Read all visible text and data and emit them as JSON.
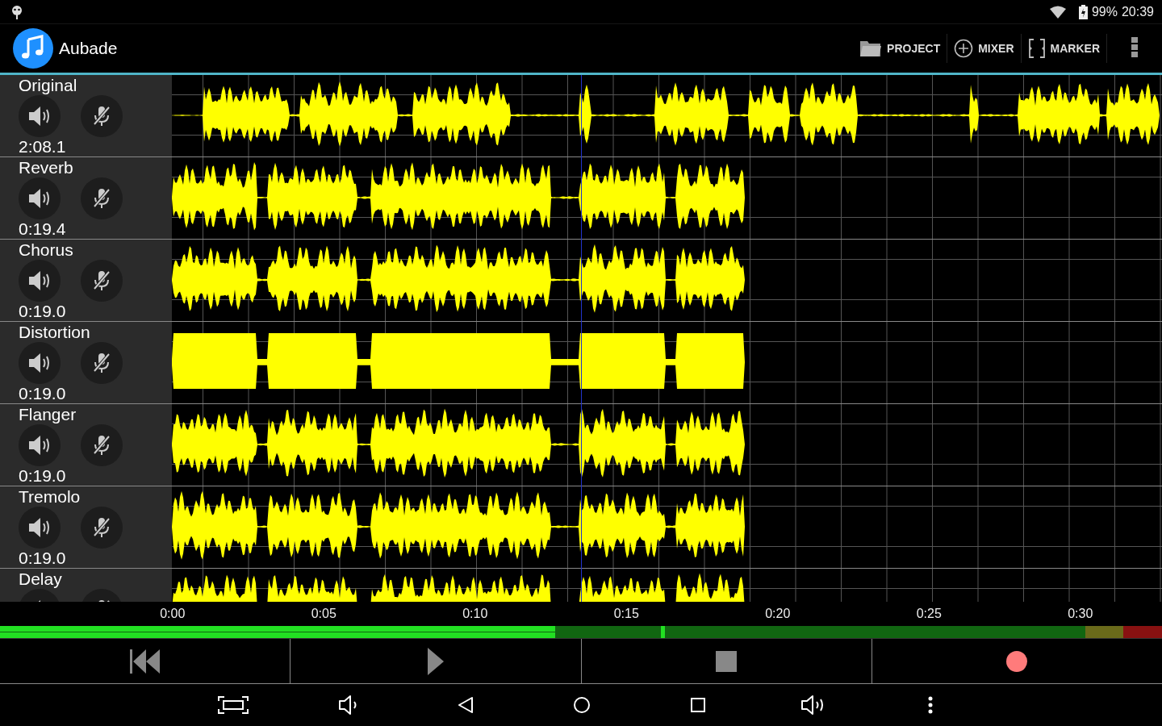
{
  "status_bar": {
    "battery": "99%",
    "time": "20:39"
  },
  "app_bar": {
    "title": "Aubade",
    "actions": [
      {
        "label": "PROJECT",
        "kind": "folder"
      },
      {
        "label": "MIXER",
        "kind": "plus"
      },
      {
        "label": "MARKER",
        "kind": "marker"
      }
    ]
  },
  "tracks": [
    {
      "name": "Original",
      "duration": "2:08.1",
      "kind": "long"
    },
    {
      "name": "Reverb",
      "duration": "0:19.4",
      "kind": "short"
    },
    {
      "name": "Chorus",
      "duration": "0:19.0",
      "kind": "short"
    },
    {
      "name": "Distortion",
      "duration": "0:19.0",
      "kind": "clipped"
    },
    {
      "name": "Flanger",
      "duration": "0:19.0",
      "kind": "short"
    },
    {
      "name": "Tremolo",
      "duration": "0:19.0",
      "kind": "short"
    },
    {
      "name": "Delay",
      "kind": "short"
    }
  ],
  "timeline": {
    "ticks": [
      "0:00",
      "0:05",
      "0:10",
      "0:15",
      "0:20",
      "0:25",
      "0:30"
    ]
  },
  "meter": {
    "level": 0.478,
    "peak": {
      "level": 0.569
    }
  }
}
